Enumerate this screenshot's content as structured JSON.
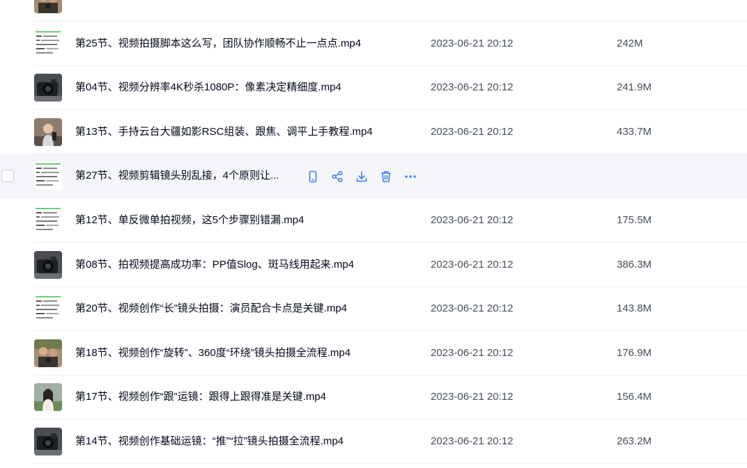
{
  "files": [
    {
      "name": "",
      "date": "",
      "size": "",
      "thumb": "people"
    },
    {
      "name": "第25节、视频拍摄脚本这么写，团队协作顺畅不止一点点.mp4",
      "date": "2023-06-21 20:12",
      "size": "242M",
      "thumb": "slide"
    },
    {
      "name": "第04节、视频分辨率4K秒杀1080P：像素决定精细度.mp4",
      "date": "2023-06-21 20:12",
      "size": "241.9M",
      "thumb": "camera"
    },
    {
      "name": "第13节、手持云台大疆如影RSC组装、跟焦、调平上手教程.mp4",
      "date": "2023-06-21 20:12",
      "size": "433.7M",
      "thumb": "person"
    },
    {
      "name": "第27节、视频剪辑镜头别乱接，4个原则让...",
      "date": "",
      "size": "",
      "thumb": "slide",
      "hovered": true
    },
    {
      "name": "第12节、单反微单拍视频，这5个步骤别错漏.mp4",
      "date": "2023-06-21 20:12",
      "size": "175.5M",
      "thumb": "slide"
    },
    {
      "name": "第08节、拍视频提高成功率：PP值Slog、斑马线用起来.mp4",
      "date": "2023-06-21 20:12",
      "size": "386.3M",
      "thumb": "camera"
    },
    {
      "name": "第20节、视频创作“长”镜头拍摄：演员配合卡点是关键.mp4",
      "date": "2023-06-21 20:12",
      "size": "143.8M",
      "thumb": "slide"
    },
    {
      "name": "第18节、视频创作“旋转”、360度“环绕”镜头拍摄全流程.mp4",
      "date": "2023-06-21 20:12",
      "size": "176.9M",
      "thumb": "people"
    },
    {
      "name": "第17节、视频创作“跟”运镜：跟得上跟得准是关键.mp4",
      "date": "2023-06-21 20:12",
      "size": "156.4M",
      "thumb": "landscape"
    },
    {
      "name": "第14节、视频创作基础运镜：“推”“拉”镜头拍摄全流程.mp4",
      "date": "2023-06-21 20:12",
      "size": "263.2M",
      "thumb": "camera"
    }
  ],
  "hover_actions": [
    {
      "icon": "phone-icon",
      "color": "#3b7ff6"
    },
    {
      "icon": "share-icon",
      "color": "#3b7ff6"
    },
    {
      "icon": "download-icon",
      "color": "#3b7ff6"
    },
    {
      "icon": "trash-icon",
      "color": "#3b7ff6"
    },
    {
      "icon": "more-icon",
      "color": "#3b7ff6"
    }
  ],
  "colors": {
    "accent": "#3b7ff6",
    "hover_bg": "#f5f6fa",
    "divider": "#eef0f4"
  }
}
